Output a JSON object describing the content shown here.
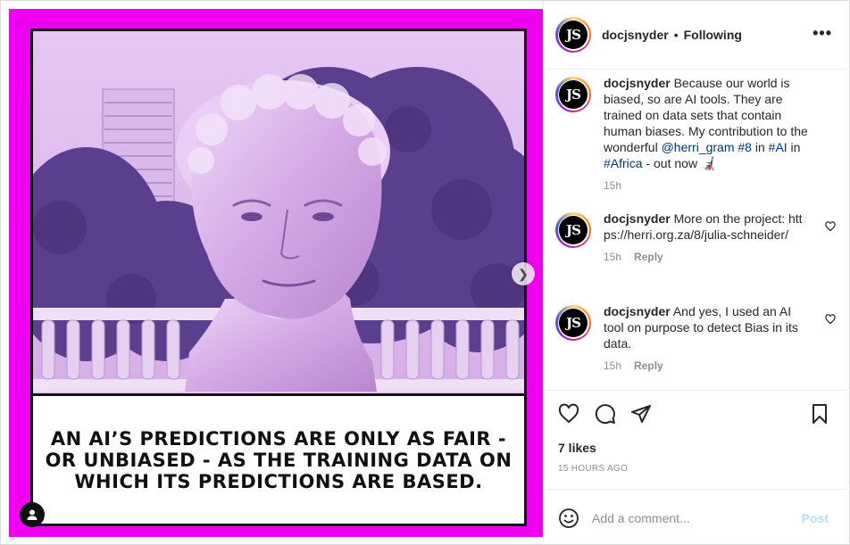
{
  "post": {
    "username": "docjsnyder",
    "separator": "•",
    "follow_status": "Following",
    "more_label": "•••",
    "avatar_initials": "JS"
  },
  "media": {
    "caption_text": "An AI’s predictions are only as fair - or unbiased - as the training data on which its predictions are based.",
    "carousel_dots": 5,
    "active_dot": 0
  },
  "comments": [
    {
      "username": "docjsnyder",
      "text_before": " Because our world is biased, so are AI tools. They are trained on data sets that contain human biases. My contribution to the wonderful ",
      "mention": "@herri_gram",
      "mid1": " ",
      "hashtag1": "#8",
      "mid2": " in ",
      "hashtag2": "#AI",
      "mid3": " in ",
      "hashtag3": "#Africa",
      "text_after": " - out now 🦼",
      "time": "15h"
    },
    {
      "username": "docjsnyder",
      "text": " More on the project: https://herri.org.za/8/julia-schneider/",
      "time": "15h",
      "reply": "Reply"
    },
    {
      "username": "docjsnyder",
      "text": " And yes, I used an AI tool on purpose to detect Bias in its data.",
      "time": "15h",
      "reply": "Reply"
    }
  ],
  "engagement": {
    "likes": "7 likes",
    "timestamp": "15 HOURS AGO"
  },
  "add_comment": {
    "placeholder": "Add a comment...",
    "post_label": "Post"
  },
  "colors": {
    "media_background": "#f000f0",
    "link": "#00376b",
    "post_disabled": "#b2dffc"
  }
}
